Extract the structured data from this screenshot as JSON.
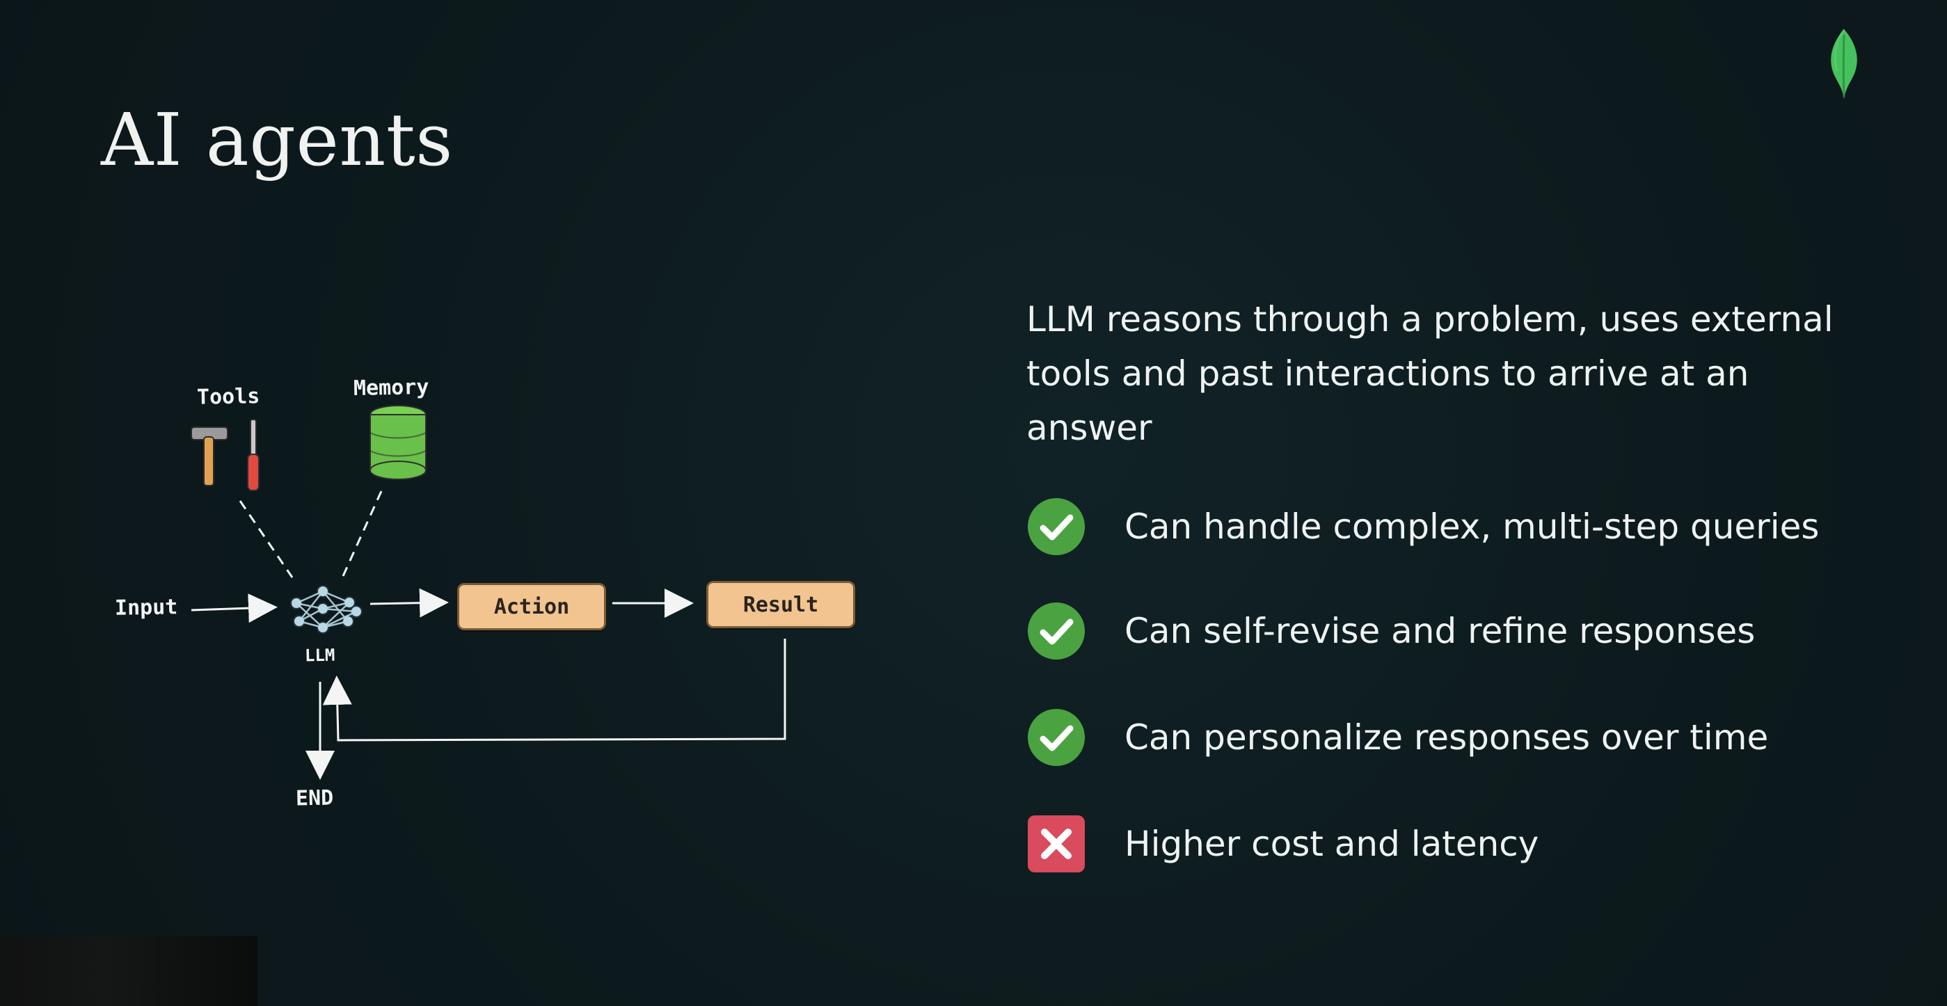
{
  "slide": {
    "title": "AI agents",
    "brand_leaf_color": "#3fbf5e"
  },
  "diagram": {
    "labels": {
      "tools": "Tools",
      "memory": "Memory",
      "input": "Input",
      "llm": "LLM",
      "end": "END"
    },
    "boxes": {
      "action": "Action",
      "result": "Result"
    },
    "colors": {
      "box_fill": "#f2c48f",
      "memory_fill": "#69c04a",
      "stroke": "#f3f5f4"
    }
  },
  "content": {
    "description": "LLM reasons through a problem, uses external tools and past interactions to arrive at an answer",
    "items": [
      {
        "status": "check",
        "text": "Can handle complex, multi-step queries",
        "color": "#4aa340"
      },
      {
        "status": "check",
        "text": "Can self-revise and refine responses",
        "color": "#4aa340"
      },
      {
        "status": "check",
        "text": "Can personalize responses over time",
        "color": "#4aa340"
      },
      {
        "status": "cross",
        "text": "Higher cost and latency",
        "color": "#d94b5d"
      }
    ]
  }
}
